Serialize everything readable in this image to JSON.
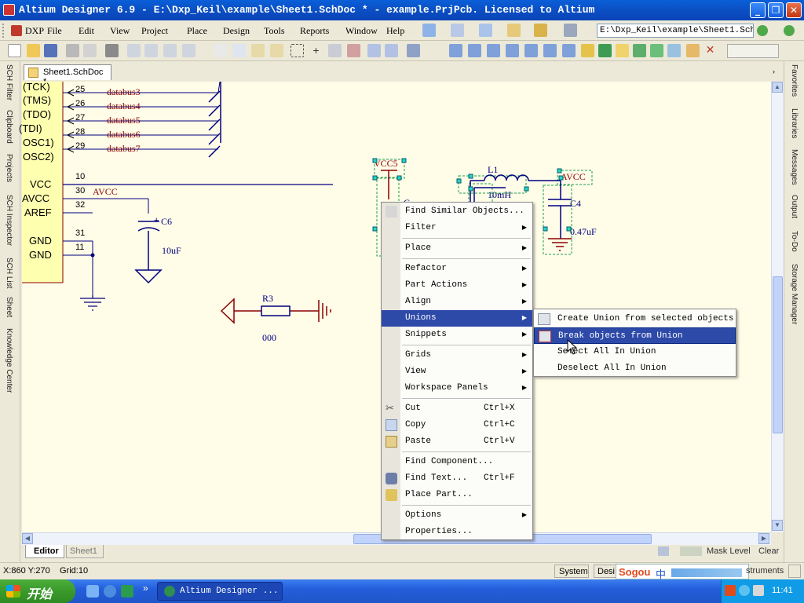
{
  "window": {
    "title": "Altium Designer 6.9 - E:\\Dxp_Keil\\example\\Sheet1.SchDoc * - example.PrjPcb. Licensed to Altium",
    "buttons": [
      "minimize",
      "restore",
      "close"
    ]
  },
  "menubar": {
    "items": [
      "DXP",
      "File",
      "Edit",
      "View",
      "Project",
      "Place",
      "Design",
      "Tools",
      "Reports",
      "Window",
      "Help"
    ],
    "path": "E:\\Dxp_Keil\\example\\Sheet1.SchI"
  },
  "document_tab": {
    "label": "Sheet1.SchDoc *"
  },
  "left_panels": [
    "SCH Filter",
    "Clipboard",
    "Projects",
    "SCH Inspector",
    "SCH List",
    "Sheet",
    "Knowledge Center"
  ],
  "right_panels": [
    "Favorites",
    "Libraries",
    "Messages",
    "Output",
    "To-Do",
    "Storage Manager"
  ],
  "schematic": {
    "pins": [
      {
        "name": "(TCK)",
        "num": "25",
        "net": "databus3"
      },
      {
        "name": "(TMS)",
        "num": "26",
        "net": "databus4"
      },
      {
        "name": "(TDO)",
        "num": "27",
        "net": "databus5"
      },
      {
        "name": "(TDI)",
        "num": "28",
        "net": "databus6"
      },
      {
        "name": "OSC1)",
        "num": "29",
        "net": "databus7"
      },
      {
        "name": "OSC2)",
        "num": "",
        "net": ""
      }
    ],
    "power_pins": [
      {
        "name": "VCC",
        "num": "10",
        "net": ""
      },
      {
        "name": "AVCC",
        "num": "30",
        "net": "AVCC"
      },
      {
        "name": "AREF",
        "num": "32",
        "net": ""
      },
      {
        "name": "GND",
        "num": "31",
        "net": ""
      },
      {
        "name": "GND",
        "num": "11",
        "net": ""
      }
    ],
    "c6": {
      "ref": "C6",
      "value": "10uF"
    },
    "r3": {
      "ref": "R3",
      "value": "000"
    },
    "vcc5": "VCC5",
    "l1": {
      "ref": "L1",
      "value": "10mH"
    },
    "c4": {
      "ref": "C4",
      "value": "0.47uF"
    },
    "avcc": "AVCC",
    "c_partial": "C"
  },
  "context_menu": {
    "items": [
      {
        "label": "Find Similar Objects...",
        "icon": "find-similar-icon",
        "shortcut": "",
        "submenu": false
      },
      {
        "label": "Filter",
        "icon": "",
        "shortcut": "",
        "submenu": true
      },
      {
        "label": "Place",
        "icon": "",
        "shortcut": "",
        "submenu": true
      },
      {
        "label": "Refactor",
        "icon": "",
        "shortcut": "",
        "submenu": true
      },
      {
        "label": "Part Actions",
        "icon": "",
        "shortcut": "",
        "submenu": true
      },
      {
        "label": "Align",
        "icon": "",
        "shortcut": "",
        "submenu": true
      },
      {
        "label": "Unions",
        "icon": "",
        "shortcut": "",
        "submenu": true,
        "selected": true
      },
      {
        "label": "Snippets",
        "icon": "",
        "shortcut": "",
        "submenu": true
      },
      {
        "label": "Grids",
        "icon": "",
        "shortcut": "",
        "submenu": true
      },
      {
        "label": "View",
        "icon": "",
        "shortcut": "",
        "submenu": true
      },
      {
        "label": "Workspace Panels",
        "icon": "",
        "shortcut": "",
        "submenu": true
      },
      {
        "label": "Cut",
        "icon": "cut-icon",
        "shortcut": "Ctrl+X",
        "submenu": false
      },
      {
        "label": "Copy",
        "icon": "copy-icon",
        "shortcut": "Ctrl+C",
        "submenu": false
      },
      {
        "label": "Paste",
        "icon": "paste-icon",
        "shortcut": "Ctrl+V",
        "submenu": false
      },
      {
        "label": "Find Component...",
        "icon": "",
        "shortcut": "",
        "submenu": false
      },
      {
        "label": "Find Text...",
        "icon": "binoculars-icon",
        "shortcut": "Ctrl+F",
        "submenu": false
      },
      {
        "label": "Place Part...",
        "icon": "place-part-icon",
        "shortcut": "",
        "submenu": false
      },
      {
        "label": "Options",
        "icon": "",
        "shortcut": "",
        "submenu": true
      },
      {
        "label": "Properties...",
        "icon": "",
        "shortcut": "",
        "submenu": false
      }
    ]
  },
  "unions_submenu": {
    "items": [
      {
        "label": "Create Union from selected objects",
        "icon": "create-union-icon",
        "selected": false
      },
      {
        "label": "Break objects from Union",
        "icon": "break-union-icon",
        "selected": true
      },
      {
        "label": "Select All In Union",
        "icon": "",
        "selected": false
      },
      {
        "label": "Deselect All In Union",
        "icon": "",
        "selected": false
      }
    ]
  },
  "editor_tabs": [
    "Editor",
    "Sheet1"
  ],
  "mask": {
    "label": "Mask Level",
    "clear": "Clear"
  },
  "status": {
    "coords": "X:860 Y:270",
    "grid": "Grid:10",
    "system": "System",
    "design": "Desi",
    "instruments": "struments"
  },
  "taskbar": {
    "start": "开始",
    "task": "Altium Designer ...",
    "clock": "11:41",
    "ime": "Sogou",
    "ime_mode": "中"
  },
  "colors": {
    "canvas": "#fffce8",
    "menu_highlight": "#2e4aa8",
    "titlebar": "#0a54cc",
    "wire": "#000080",
    "component": "#000080",
    "power_red": "#8b0000"
  }
}
